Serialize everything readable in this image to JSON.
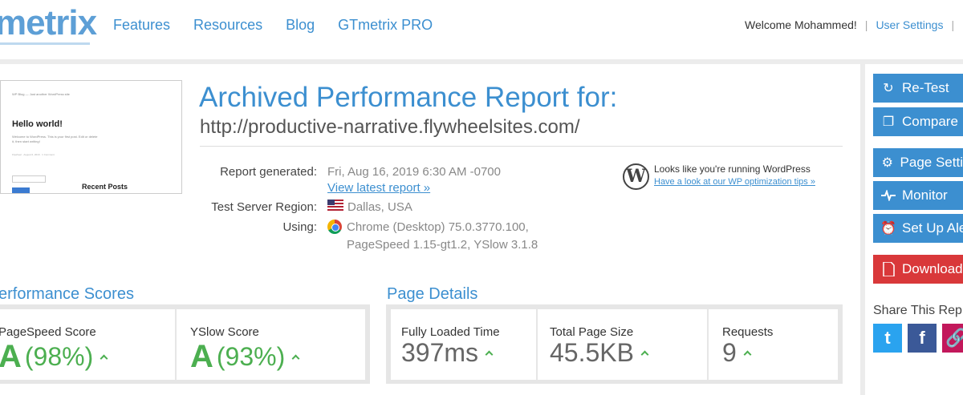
{
  "header": {
    "logo": "metrix",
    "nav": [
      {
        "label": "Features"
      },
      {
        "label": "Resources"
      },
      {
        "label": "Blog"
      },
      {
        "label": "GTmetrix PRO"
      }
    ],
    "welcome": "Welcome Mohammed!",
    "separator": "|",
    "user_settings": "User Settings"
  },
  "thumbnail": {
    "site_title": "WP Blog",
    "tagline": "Just another WordPress site",
    "post_title": "Hello world!",
    "post_body": "Welcome to WordPress. This is your first post. Edit or delete it, then start writing!",
    "meta": "Flywheel · August 6, 2019 · 1 Comment",
    "sidebar_heading": "Recent Posts",
    "search_btn": "Search"
  },
  "report": {
    "title": "Archived Performance Report for:",
    "url": "http://productive-narrative.flywheelsites.com/",
    "generated_label": "Report generated:",
    "generated_value": "Fri, Aug 16, 2019 6:30 AM -0700",
    "latest_link": "View latest report »",
    "region_label": "Test Server Region:",
    "region_value": "Dallas, USA",
    "using_label": "Using:",
    "using_line1": "Chrome (Desktop) 75.0.3770.100,",
    "using_line2": "PageSpeed 1.15-gt1.2, YSlow 3.1.8",
    "wp_line1": "Looks like you're running WordPress",
    "wp_line2": "Have a look at our WP optimization tips »",
    "wp_glyph": "W"
  },
  "scores": {
    "title": "erformance Scores",
    "pagespeed_label": "PageSpeed Score",
    "pagespeed_grade": "A",
    "pagespeed_pct": "(98%)",
    "yslow_label": "YSlow Score",
    "yslow_grade": "A",
    "yslow_pct": "(93%)"
  },
  "details": {
    "title": "Page Details",
    "load_label": "Fully Loaded Time",
    "load_value": "397ms",
    "size_label": "Total Page Size",
    "size_value": "45.5KB",
    "req_label": "Requests",
    "req_value": "9"
  },
  "sidebar": {
    "retest": "Re-Test",
    "compare": "Compare",
    "page_settings": "Page Setti",
    "monitor": "Monitor",
    "alerts": "Set Up Ale",
    "download": "Download",
    "share": "Share This Rep",
    "twitter": "t",
    "facebook": "f"
  },
  "colors": {
    "accent": "#3c8fd0",
    "grade_green": "#4caf50",
    "download_red": "#d9383a"
  }
}
